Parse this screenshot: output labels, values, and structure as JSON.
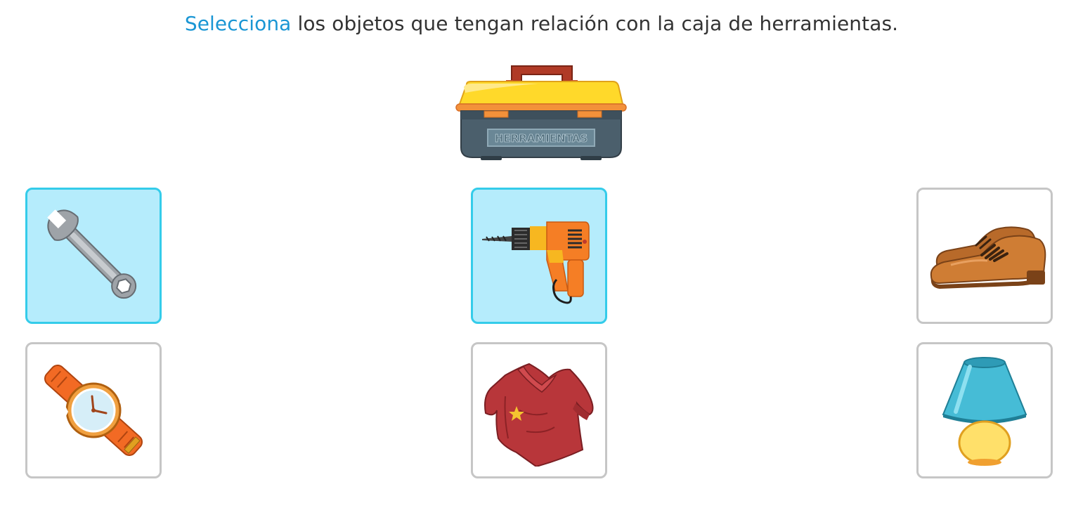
{
  "instruction": {
    "highlight": "Selecciona",
    "rest": " los objetos que tengan relación con la caja de herramientas."
  },
  "toolbox": {
    "label": "HERRAMIENTAS",
    "icon": "toolbox-icon"
  },
  "options": [
    {
      "icon": "wrench-icon",
      "selected": true
    },
    {
      "icon": "drill-icon",
      "selected": true
    },
    {
      "icon": "shoes-icon",
      "selected": false
    },
    {
      "icon": "wristwatch-icon",
      "selected": false
    },
    {
      "icon": "sweater-icon",
      "selected": false
    },
    {
      "icon": "lamp-icon",
      "selected": false
    }
  ],
  "colors": {
    "accent": "#1a96d4",
    "selected_border": "#34ccea",
    "selected_fill": "#b5ecfc",
    "card_border": "#c6c6c6"
  }
}
